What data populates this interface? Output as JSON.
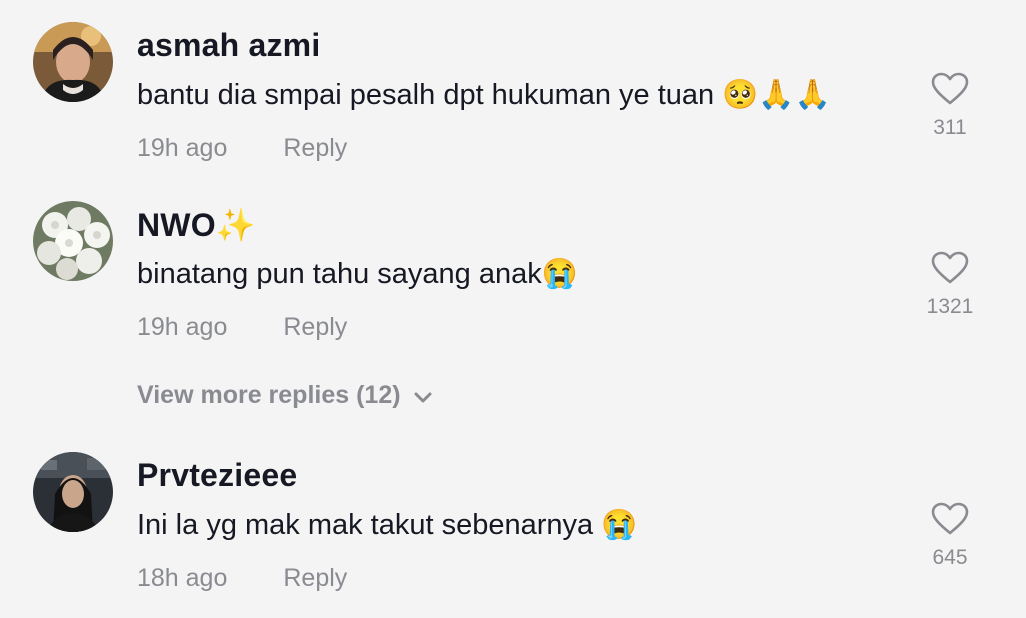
{
  "comments": [
    {
      "username": "asmah azmi",
      "text": "bantu dia smpai pesalh dpt hukuman ye tuan 🥺🙏🙏",
      "time": "19h ago",
      "reply_label": "Reply",
      "likes": "311",
      "avatar_icon": "user-photo-avatar"
    },
    {
      "username": "NWO✨",
      "text": "binatang pun tahu sayang anak😭",
      "time": "19h ago",
      "reply_label": "Reply",
      "likes": "1321",
      "avatar_icon": "white-flowers-avatar"
    },
    {
      "username": "Prvtezieee",
      "text": "Ini la yg mak mak takut sebenarnya 😭",
      "time": "18h ago",
      "reply_label": "Reply",
      "likes": "645",
      "avatar_icon": "user-photo-avatar"
    }
  ],
  "view_more": {
    "label": "View more replies (12)"
  },
  "colors": {
    "background": "#f4f4f4",
    "text_primary": "#161823",
    "text_secondary": "#8a8b91"
  }
}
